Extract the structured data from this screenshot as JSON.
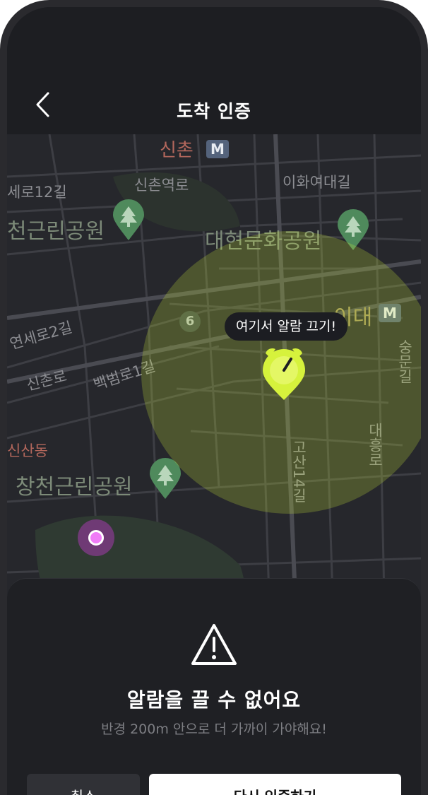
{
  "header": {
    "title": "도착 인증",
    "back_icon": "chevron-left-icon"
  },
  "map": {
    "labels": {
      "sinchon": "신촌",
      "sinchonyeok_ro": "신촌역로",
      "ewha_yeodae_gil": "이화여대길",
      "yonsei_ro_12gil": "세로12길",
      "changcheon_park_top": "천근린공원",
      "daehyeon_park": "대현문화공원",
      "idae": "이대",
      "yonsei_ro_2gil": "연세로2길",
      "sinchon_ro": "신촌로",
      "baekbeom_ro_1gil": "백범로1길",
      "sinsan_dong": "신산동",
      "changcheon_park": "창천근린공원",
      "gosan_14gil": "고산14길",
      "daeheung_ro": "대흥로",
      "sinchon_ro_right": "숭문길"
    },
    "metro_badge": "M",
    "route_number": "6",
    "pin_tooltip": "여기서 알람 끄기!",
    "colors": {
      "radius_fill": "#cdeb3c",
      "alarm_pin": "#d6f23c",
      "current_location": "#f07cf7"
    }
  },
  "sheet": {
    "warning_icon": "warning-triangle-icon",
    "title": "알람을 끌 수 없어요",
    "description": "반경 200m 안으로 더 가까이 가야해요!",
    "cancel_label": "취소",
    "primary_label": "다시 인증하기"
  }
}
